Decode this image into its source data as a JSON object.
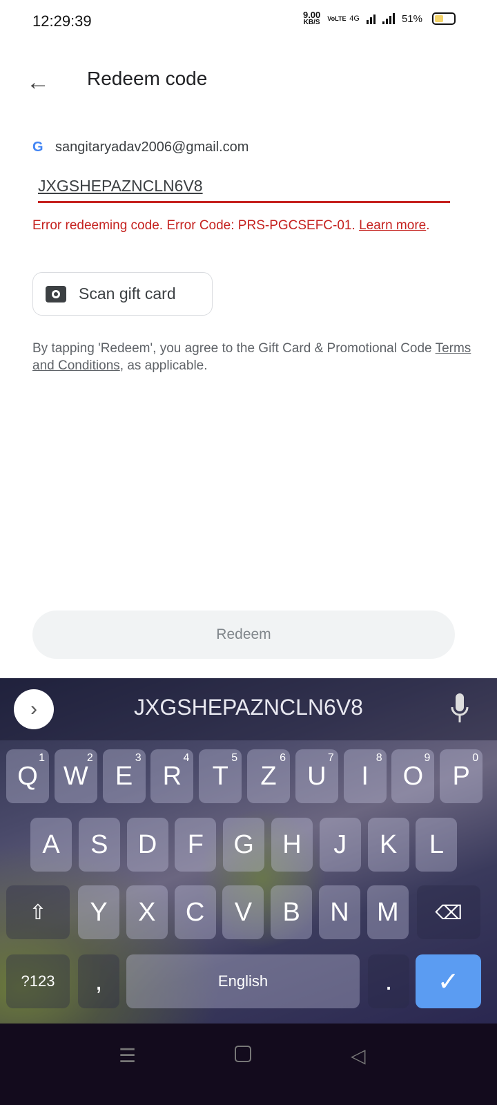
{
  "status": {
    "time": "12:29:39",
    "speed": "9.00",
    "speed_unit": "KB/S",
    "volte": "VoLTE",
    "network": "4G",
    "battery": "51%",
    "battery_level": 0.51
  },
  "header": {
    "title": "Redeem code"
  },
  "account": {
    "email": "sangitaryadav2006@gmail.com"
  },
  "code_field": {
    "value": "JXGSHEPAZNCLN6V8"
  },
  "error": {
    "text": "Error redeeming code. Error Code: PRS-PGCSEFC-01. ",
    "link": "Learn more",
    "end": "."
  },
  "scan": {
    "label": "Scan gift card"
  },
  "terms": {
    "pre": "By tapping 'Redeem', you agree to the Gift Card & Promotional Code ",
    "link": "Terms and Conditions",
    "post": ", as applicable."
  },
  "redeem": {
    "label": "Redeem"
  },
  "keyboard": {
    "suggestion": "JXGSHEPAZNCLN6V8",
    "row1": [
      "Q",
      "W",
      "E",
      "R",
      "T",
      "Z",
      "U",
      "I",
      "O",
      "P"
    ],
    "row1_hints": [
      "1",
      "2",
      "3",
      "4",
      "5",
      "6",
      "7",
      "8",
      "9",
      "0"
    ],
    "row2": [
      "A",
      "S",
      "D",
      "F",
      "G",
      "H",
      "J",
      "K",
      "L"
    ],
    "row3": [
      "Y",
      "X",
      "C",
      "V",
      "B",
      "N",
      "M"
    ],
    "symbols": "?123",
    "comma": ",",
    "space": "English",
    "period": ".",
    "enter_color": "#5b9cf2"
  }
}
